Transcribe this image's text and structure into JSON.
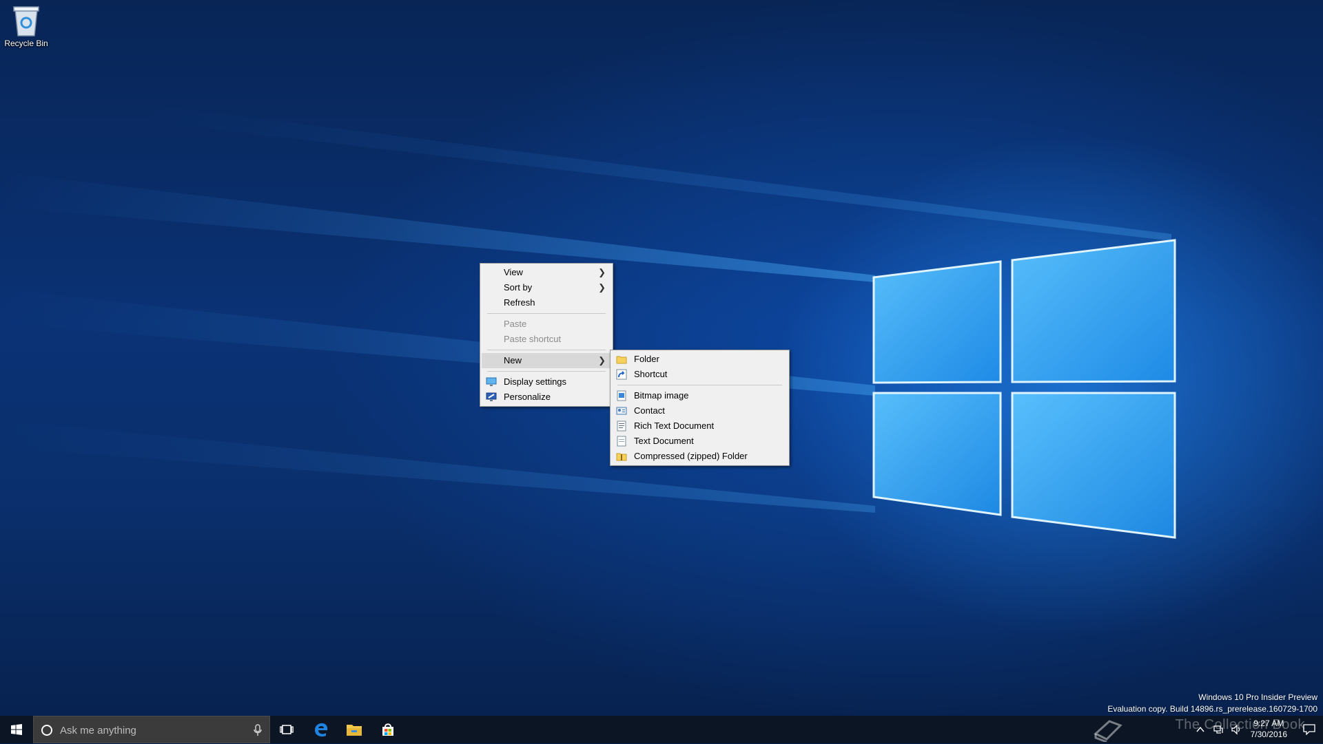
{
  "desktop": {
    "icons": [
      {
        "label": "Recycle Bin",
        "icon": "recycle-bin-icon"
      }
    ]
  },
  "context_menu": {
    "items": [
      {
        "label": "View",
        "submenu": true
      },
      {
        "label": "Sort by",
        "submenu": true
      },
      {
        "label": "Refresh"
      },
      {
        "label": "Paste",
        "disabled": true
      },
      {
        "label": "Paste shortcut",
        "disabled": true
      },
      {
        "label": "New",
        "submenu": true,
        "highlighted": true
      },
      {
        "label": "Display settings",
        "icon": "display-settings-icon"
      },
      {
        "label": "Personalize",
        "icon": "personalize-icon"
      }
    ]
  },
  "new_submenu": {
    "items": [
      {
        "label": "Folder",
        "icon": "folder-icon"
      },
      {
        "label": "Shortcut",
        "icon": "shortcut-icon"
      },
      {
        "label": "Bitmap image",
        "icon": "bitmap-image-icon"
      },
      {
        "label": "Contact",
        "icon": "contact-icon"
      },
      {
        "label": "Rich Text Document",
        "icon": "rich-text-document-icon"
      },
      {
        "label": "Text Document",
        "icon": "text-document-icon"
      },
      {
        "label": "Compressed (zipped) Folder",
        "icon": "zip-folder-icon"
      }
    ]
  },
  "watermark": {
    "line1": "Windows 10 Pro Insider Preview",
    "line2": "Evaluation copy. Build 14896.rs_prerelease.160729-1700"
  },
  "taskbar": {
    "search_placeholder": "Ask me anything",
    "pinned": [
      "task-view-icon",
      "edge-icon",
      "file-explorer-icon",
      "store-icon"
    ],
    "clock": {
      "time": "9:27 AM",
      "date": "7/30/2016"
    },
    "overlay_text": "The Collection Book",
    "colors": {
      "taskbar": "#0b1524",
      "search_box": "#3b3b3b",
      "accent": "#1e90ff"
    }
  }
}
